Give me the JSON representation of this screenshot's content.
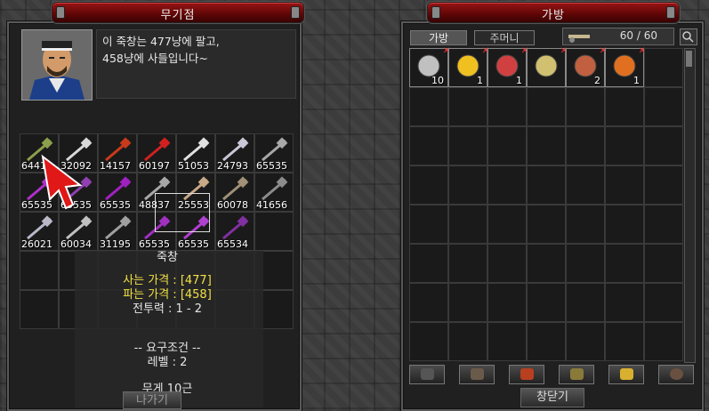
{
  "shop": {
    "title": "무기점",
    "dialogue_line1": "이 죽창는 477냥에 팔고,",
    "dialogue_line2": "458냥에 사들입니다~",
    "items": [
      {
        "name": "weapon-spear",
        "num": "64419",
        "color": "#8c9f4c"
      },
      {
        "name": "weapon-dagger",
        "num": "32092",
        "color": "#d8d8d8"
      },
      {
        "name": "weapon-firespear",
        "num": "14157",
        "color": "#c83a1a"
      },
      {
        "name": "weapon-redsword",
        "num": "60197",
        "color": "#d02020"
      },
      {
        "name": "weapon-sword",
        "num": "51053",
        "color": "#e0e0e0"
      },
      {
        "name": "weapon-lightsword",
        "num": "24793",
        "color": "#c8c8d8"
      },
      {
        "name": "weapon-axe",
        "num": "65535",
        "color": "#a8a8a8"
      },
      {
        "name": "weapon-purpleblade",
        "num": "65535",
        "color": "#b030c8"
      },
      {
        "name": "weapon-purplespear",
        "num": "65535",
        "color": "#9040b0"
      },
      {
        "name": "weapon-purplesword",
        "num": "65535",
        "color": "#a020c0"
      },
      {
        "name": "weapon-staff",
        "num": "48837",
        "color": "#a8a8a8"
      },
      {
        "name": "weapon-greataxe",
        "num": "25553",
        "color": "#c8a888"
      },
      {
        "name": "weapon-battleaxe",
        "num": "60078",
        "color": "#a09078"
      },
      {
        "name": "weapon-waraxe",
        "num": "41656",
        "color": "#8c8c8c"
      },
      {
        "name": "weapon-doubleaxe",
        "num": "26021",
        "color": "#b8b8c8"
      },
      {
        "name": "weapon-handaxe",
        "num": "60034",
        "color": "#c0c0c0"
      },
      {
        "name": "weapon-scythe",
        "num": "31195",
        "color": "#a0a0a0"
      },
      {
        "name": "weapon-purpleclaw",
        "num": "65535",
        "color": "#a030c0"
      },
      {
        "name": "weapon-purplefan",
        "num": "65535",
        "color": "#b040d0"
      },
      {
        "name": "weapon-purplehook",
        "num": "65534",
        "color": "#8030a0"
      }
    ],
    "item_name": "죽창",
    "buy_price": "사는 가격 : [477]",
    "sell_price": "파는 가격 : [458]",
    "power": "전투력 : 1 - 2",
    "req_header": "-- 요구조건 --",
    "level": "레벨    : 2",
    "weight": "무게 10근",
    "exit_button": "나가기"
  },
  "bag": {
    "title": "가방",
    "tab_bag": "가방",
    "tab_pouch": "주머니",
    "capacity": "60 / 60",
    "items": [
      {
        "name": "coin-item",
        "qty": "10"
      },
      {
        "name": "scroll-item",
        "qty": "1"
      },
      {
        "name": "orb-item",
        "qty": "1"
      },
      {
        "name": "pendant-item",
        "qty": ""
      },
      {
        "name": "meat-item",
        "qty": "2"
      },
      {
        "name": "fire-orb-item",
        "qty": "1"
      }
    ],
    "close_button": "창닫기"
  }
}
